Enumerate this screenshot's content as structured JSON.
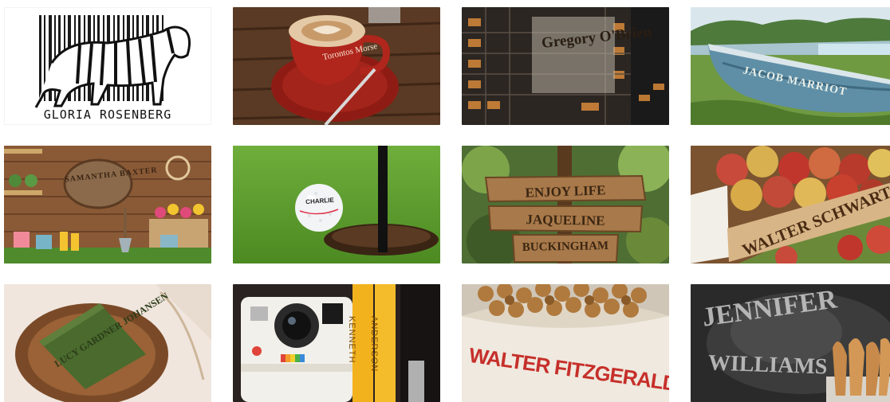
{
  "gallery": {
    "tiles": [
      {
        "id": "zebra-barcode",
        "names": [
          "GLORIA ROSENBERG"
        ]
      },
      {
        "id": "coffee-cup",
        "names": [
          "Torontos Morse"
        ]
      },
      {
        "id": "building-facade",
        "names": [
          "Gregory O'Brien"
        ]
      },
      {
        "id": "old-boat",
        "names": [
          "JACOB MARRIOT"
        ]
      },
      {
        "id": "garden-sign",
        "names": [
          "SAMANTHA BAXTER"
        ]
      },
      {
        "id": "golf-ball",
        "names": [
          "CHARLIE"
        ]
      },
      {
        "id": "wooden-signpost",
        "names": [
          "ENJOY LIFE",
          "JAQUELINE",
          "BUCKINGHAM"
        ]
      },
      {
        "id": "apple-crate",
        "names": [
          "WALTER SCHWARTZ"
        ]
      },
      {
        "id": "olive-soap",
        "names": [
          "LUCY GARDNER JOHANSEN"
        ]
      },
      {
        "id": "camera-books",
        "names": [
          "KENNETH",
          "ANDERSON"
        ]
      },
      {
        "id": "walnut-sack",
        "names": [
          "WALTER FITZGERALD"
        ]
      },
      {
        "id": "flour-chalkboard",
        "names": [
          "JENNIFER",
          "WILLIAMS"
        ]
      }
    ]
  },
  "colors": {
    "page_background": "#ffffff",
    "sign_wood": "#a8794a",
    "sack_ink": "#c62f2a"
  }
}
